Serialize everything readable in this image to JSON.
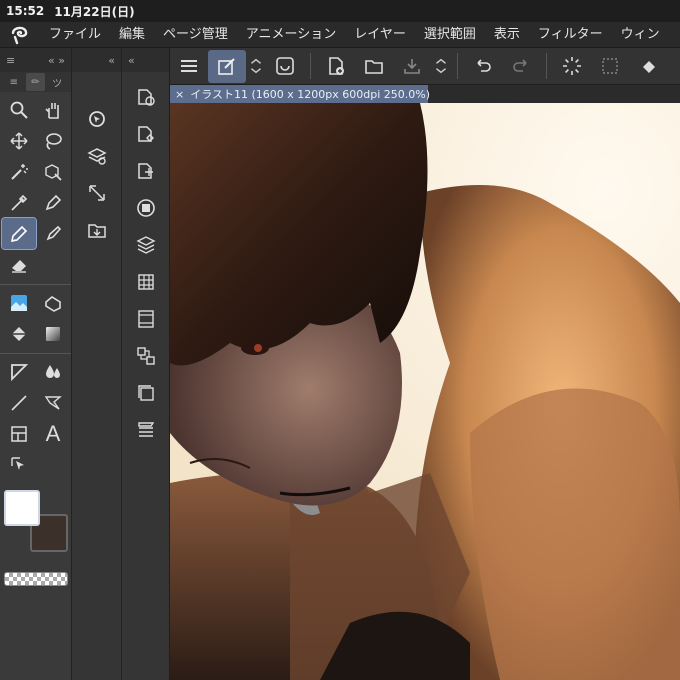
{
  "status": {
    "time": "15:52",
    "date": "11月22日(日)"
  },
  "menu": [
    "ファイル",
    "編集",
    "ページ管理",
    "アニメーション",
    "レイヤー",
    "選択範囲",
    "表示",
    "フィルター",
    "ウィン"
  ],
  "left_panel": {
    "header_left": "≡",
    "header_right": "« »",
    "tabs": [
      "≡",
      "✏",
      "ツ"
    ]
  },
  "tools": [
    {
      "name": "zoom-tool",
      "icon": "magnifier-icon"
    },
    {
      "name": "hand-tool",
      "icon": "hand-icon"
    },
    {
      "name": "move-tool",
      "icon": "move-arrows-icon"
    },
    {
      "name": "lasso-tool",
      "icon": "lasso-icon"
    },
    {
      "name": "magic-wand-tool",
      "icon": "wand-icon"
    },
    {
      "name": "object-tool",
      "icon": "cube-arrow-icon"
    },
    {
      "name": "eyedropper-tool",
      "icon": "eyedropper-icon"
    },
    {
      "name": "pen-tool",
      "icon": "pen-icon"
    },
    {
      "name": "pencil-tool",
      "icon": "pencil-icon",
      "selected": true
    },
    {
      "name": "brush-tool",
      "icon": "brush-icon"
    },
    {
      "name": "eraser-tool",
      "icon": "eraser-icon"
    },
    {
      "name": "decoration-tool",
      "icon": "decoration-icon"
    },
    {
      "name": "blend-tool",
      "icon": "blend-icon"
    },
    {
      "name": "fill-tool",
      "icon": "bucket-icon"
    },
    {
      "name": "gradient-tool",
      "icon": "gradient-icon"
    },
    {
      "name": "figure-tool",
      "icon": "ruler-triangle-icon"
    },
    {
      "name": "blur-tool",
      "icon": "droplets-icon"
    },
    {
      "name": "line-tool",
      "icon": "line-icon"
    },
    {
      "name": "balloon-tool",
      "icon": "balloon-icon"
    },
    {
      "name": "frame-tool",
      "icon": "frame-icon"
    },
    {
      "name": "text-tool",
      "icon": "text-icon",
      "label": "A"
    },
    {
      "name": "operation-tool",
      "icon": "pointer-icon"
    }
  ],
  "colors": {
    "main": "#ffffff",
    "sub": "#3b302a"
  },
  "doc_tab": {
    "close": "×",
    "title": "イラスト11 (1600 x 1200px 600dpi 250.0%)"
  },
  "accent": "#5c6d8d"
}
